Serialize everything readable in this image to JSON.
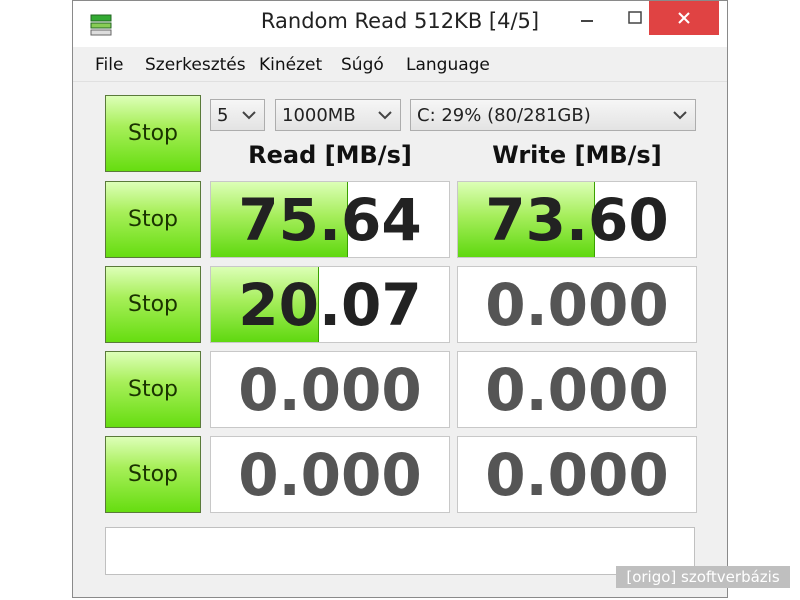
{
  "window": {
    "title": "Random Read 512KB [4/5]"
  },
  "menu": [
    "File",
    "Szerkesztés",
    "Kinézet",
    "Súgó",
    "Language"
  ],
  "controls": {
    "count": "5",
    "size": "1000MB",
    "drive": "C: 29% (80/281GB)"
  },
  "headers": {
    "read": "Read [MB/s]",
    "write": "Write [MB/s]"
  },
  "rows": [
    {
      "stop": "Stop",
      "read": "75.64",
      "write": "73.60",
      "read_progress": 0.57,
      "write_progress": 0.57
    },
    {
      "stop": "Stop",
      "read": "20.07",
      "write": "0.000",
      "read_progress": 0.45,
      "write_progress": 0
    },
    {
      "stop": "Stop",
      "read": "0.000",
      "write": "0.000",
      "read_progress": 0,
      "write_progress": 0
    },
    {
      "stop": "Stop",
      "read": "0.000",
      "write": "0.000",
      "read_progress": 0,
      "write_progress": 0
    }
  ],
  "top_stop": "Stop",
  "status": "",
  "watermark": "[origo] szoftverbázis",
  "colors": {
    "button_green": "#66dd10",
    "bar_green": "#5fd80f",
    "close_red": "#e04343"
  }
}
